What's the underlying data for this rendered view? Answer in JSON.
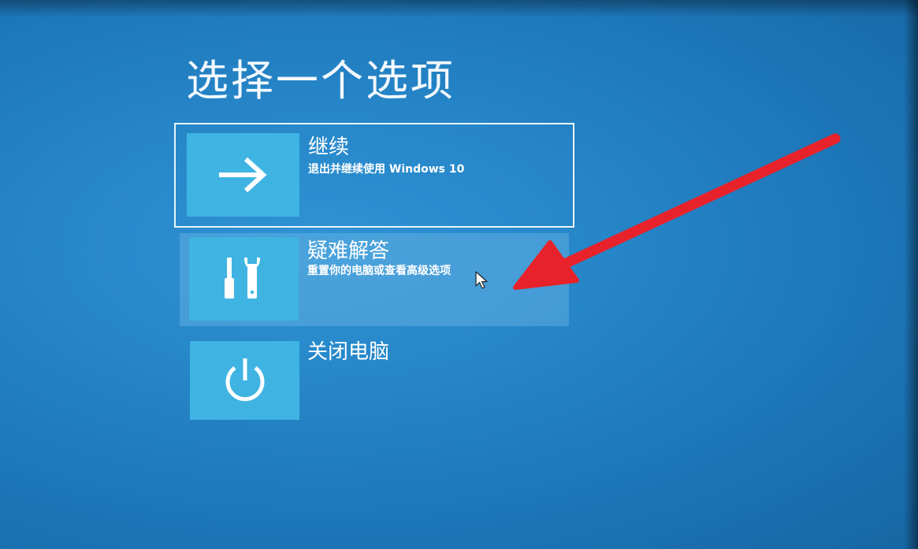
{
  "screen": {
    "title": "选择一个选项"
  },
  "options": [
    {
      "title": "继续",
      "description": "退出并继续使用 Windows 10",
      "icon": "arrow-right-icon",
      "state": "selected"
    },
    {
      "title": "疑难解答",
      "description": "重置你的电脑或查看高级选项",
      "icon": "tools-icon",
      "state": "hovered"
    },
    {
      "title": "关闭电脑",
      "description": "",
      "icon": "power-icon",
      "state": "normal"
    }
  ],
  "colors": {
    "background": "#2585c7",
    "tile": "#3fb4e3",
    "annotation_arrow": "#e8222a",
    "text": "#ffffff"
  }
}
